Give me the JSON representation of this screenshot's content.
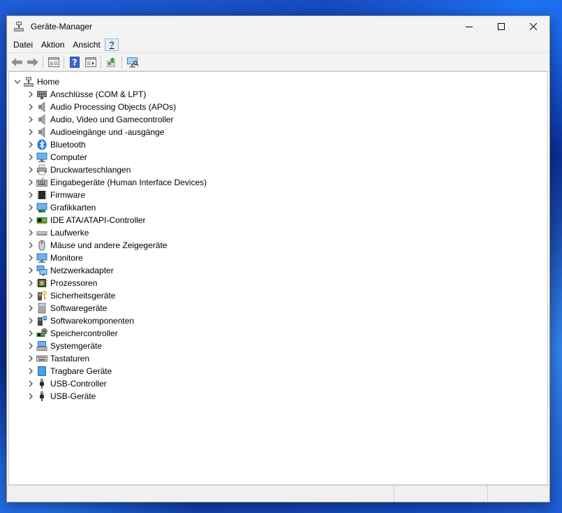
{
  "window": {
    "title": "Geräte-Manager"
  },
  "menu": [
    {
      "name": "menu-datei",
      "label": "Datei"
    },
    {
      "name": "menu-aktion",
      "label": "Aktion"
    },
    {
      "name": "menu-ansicht",
      "label": "Ansicht"
    },
    {
      "name": "menu-hilfe",
      "label": "?"
    }
  ],
  "toolbar": {
    "buttons": [
      "back-icon",
      "forward-icon",
      "properties-icon",
      "help-icon",
      "action-pane-icon",
      "update-driver-icon",
      "scan-hardware-icon"
    ]
  },
  "tree": {
    "root": {
      "label": "Home",
      "icon": "computer-home-icon"
    },
    "items": [
      {
        "label": "Anschlüsse (COM & LPT)",
        "icon": "port-icon"
      },
      {
        "label": "Audio Processing Objects (APOs)",
        "icon": "speaker-icon"
      },
      {
        "label": "Audio, Video und Gamecontroller",
        "icon": "speaker-icon"
      },
      {
        "label": "Audioeingänge und -ausgänge",
        "icon": "speaker-icon"
      },
      {
        "label": "Bluetooth",
        "icon": "bluetooth-icon"
      },
      {
        "label": "Computer",
        "icon": "monitor-icon"
      },
      {
        "label": "Druckwarteschlangen",
        "icon": "printer-icon"
      },
      {
        "label": "Eingabegeräte (Human Interface Devices)",
        "icon": "hid-icon"
      },
      {
        "label": "Firmware",
        "icon": "chip-icon"
      },
      {
        "label": "Grafikkarten",
        "icon": "display-adapter-icon"
      },
      {
        "label": "IDE ATA/ATAPI-Controller",
        "icon": "ide-controller-icon"
      },
      {
        "label": "Laufwerke",
        "icon": "disk-drive-icon"
      },
      {
        "label": "Mäuse und andere Zeigegeräte",
        "icon": "mouse-icon"
      },
      {
        "label": "Monitore",
        "icon": "monitor-icon"
      },
      {
        "label": "Netzwerkadapter",
        "icon": "network-icon"
      },
      {
        "label": "Prozessoren",
        "icon": "processor-icon"
      },
      {
        "label": "Sicherheitsgeräte",
        "icon": "security-key-icon"
      },
      {
        "label": "Softwaregeräte",
        "icon": "software-device-icon"
      },
      {
        "label": "Softwarekomponenten",
        "icon": "software-component-icon"
      },
      {
        "label": "Speichercontroller",
        "icon": "storage-controller-icon"
      },
      {
        "label": "Systemgeräte",
        "icon": "system-device-icon"
      },
      {
        "label": "Tastaturen",
        "icon": "keyboard-icon"
      },
      {
        "label": "Tragbare Geräte",
        "icon": "portable-device-icon"
      },
      {
        "label": "USB-Controller",
        "icon": "usb-icon"
      },
      {
        "label": "USB-Geräte",
        "icon": "usb-icon"
      }
    ]
  },
  "colors": {
    "accent": "#0067c0",
    "titlebar": "#f3f3f3"
  }
}
